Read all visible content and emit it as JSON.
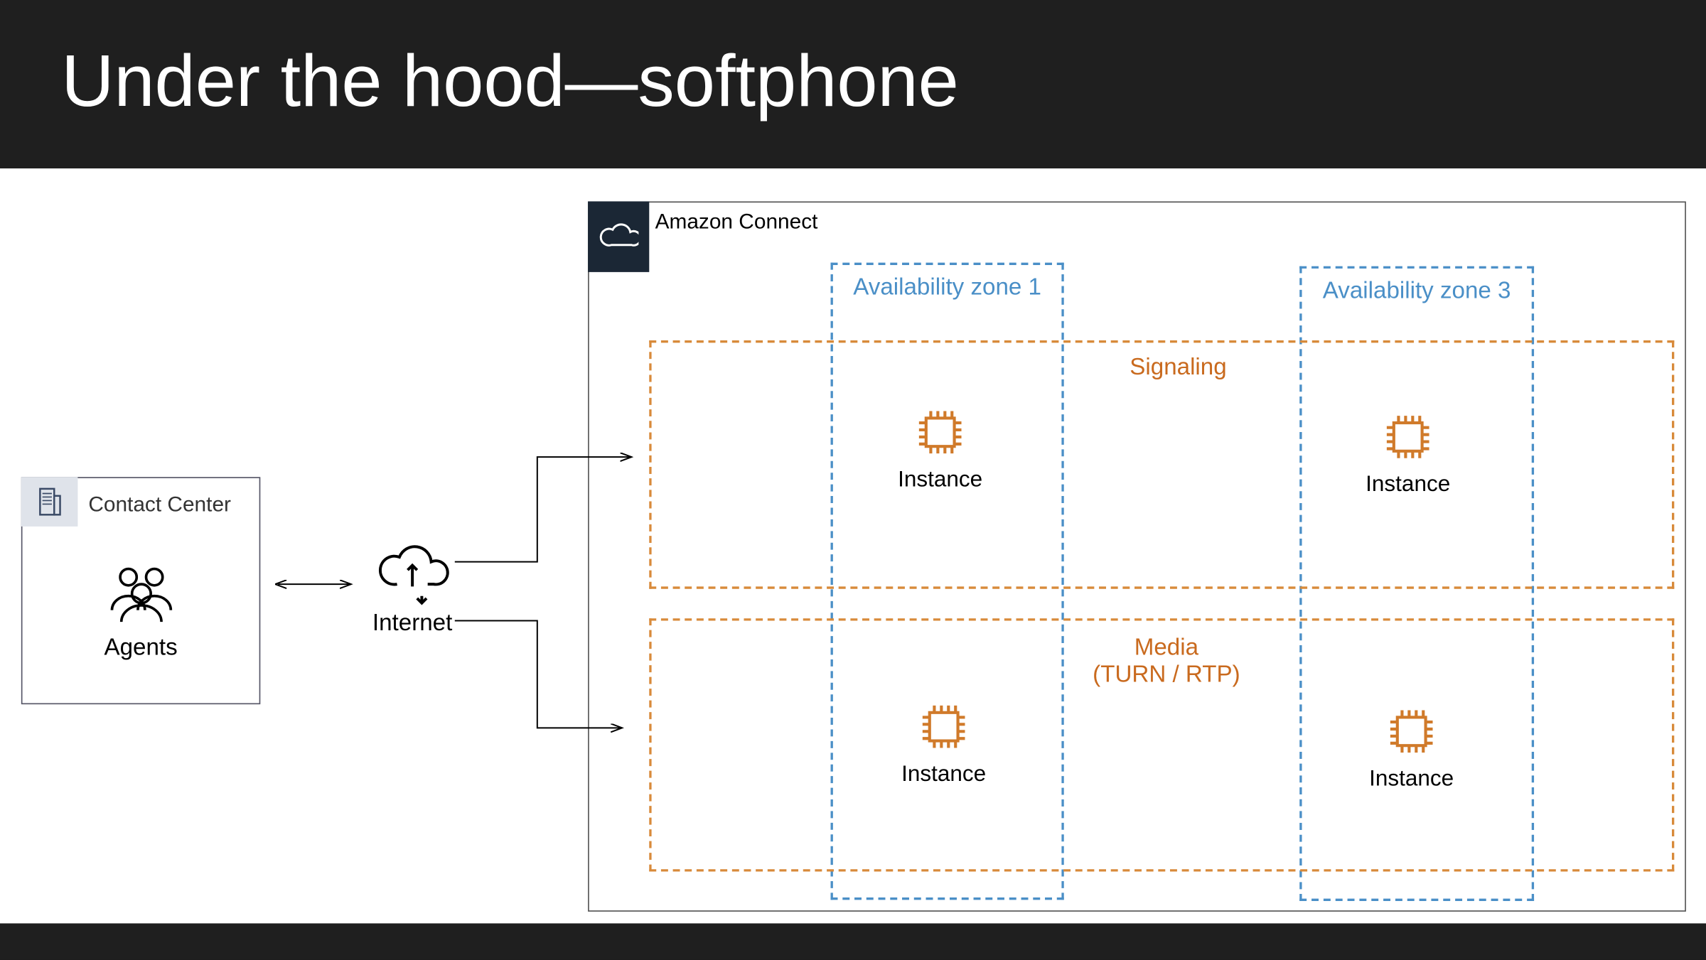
{
  "title": "Under the hood—softphone",
  "contact_center": {
    "label": "Contact Center",
    "agents_label": "Agents"
  },
  "internet": {
    "label": "Internet"
  },
  "connect": {
    "label": "Amazon Connect"
  },
  "az": {
    "one": "Availability zone 1",
    "three": "Availability zone 3"
  },
  "regions": {
    "signaling": "Signaling",
    "media_line1": "Media",
    "media_line2": "(TURN / RTP)"
  },
  "instance_label": "Instance"
}
